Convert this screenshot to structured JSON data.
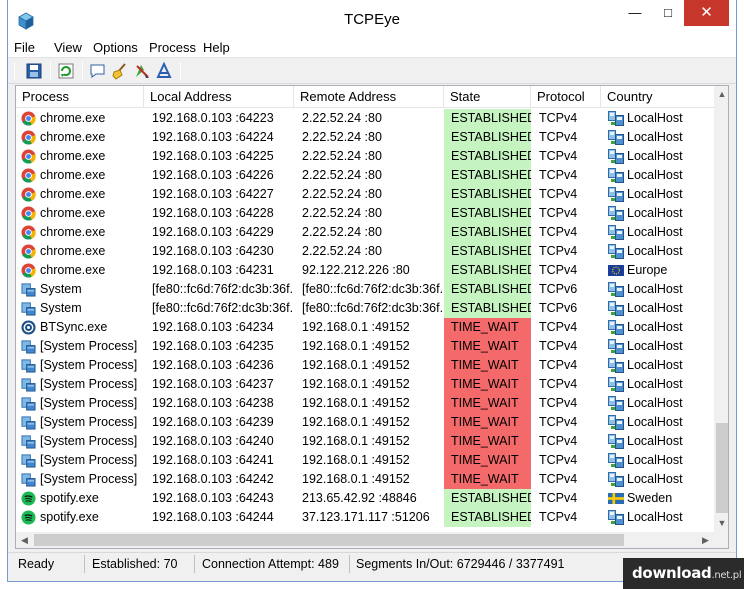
{
  "window": {
    "title": "TCPEye"
  },
  "menu": [
    "File",
    "View",
    "Options",
    "Process",
    "Help"
  ],
  "columns": [
    "Process",
    "Local Address",
    "Remote Address",
    "State",
    "Protocol",
    "Country"
  ],
  "rows": [
    {
      "icon": "chrome",
      "process": "chrome.exe",
      "local": "192.168.0.103 :64223",
      "remote": "2.22.52.24 :80",
      "state": "ESTABLISHED",
      "protocol": "TCPv4",
      "flag": "localhost",
      "country": "LocalHost"
    },
    {
      "icon": "chrome",
      "process": "chrome.exe",
      "local": "192.168.0.103 :64224",
      "remote": "2.22.52.24 :80",
      "state": "ESTABLISHED",
      "protocol": "TCPv4",
      "flag": "localhost",
      "country": "LocalHost"
    },
    {
      "icon": "chrome",
      "process": "chrome.exe",
      "local": "192.168.0.103 :64225",
      "remote": "2.22.52.24 :80",
      "state": "ESTABLISHED",
      "protocol": "TCPv4",
      "flag": "localhost",
      "country": "LocalHost"
    },
    {
      "icon": "chrome",
      "process": "chrome.exe",
      "local": "192.168.0.103 :64226",
      "remote": "2.22.52.24 :80",
      "state": "ESTABLISHED",
      "protocol": "TCPv4",
      "flag": "localhost",
      "country": "LocalHost"
    },
    {
      "icon": "chrome",
      "process": "chrome.exe",
      "local": "192.168.0.103 :64227",
      "remote": "2.22.52.24 :80",
      "state": "ESTABLISHED",
      "protocol": "TCPv4",
      "flag": "localhost",
      "country": "LocalHost"
    },
    {
      "icon": "chrome",
      "process": "chrome.exe",
      "local": "192.168.0.103 :64228",
      "remote": "2.22.52.24 :80",
      "state": "ESTABLISHED",
      "protocol": "TCPv4",
      "flag": "localhost",
      "country": "LocalHost"
    },
    {
      "icon": "chrome",
      "process": "chrome.exe",
      "local": "192.168.0.103 :64229",
      "remote": "2.22.52.24 :80",
      "state": "ESTABLISHED",
      "protocol": "TCPv4",
      "flag": "localhost",
      "country": "LocalHost"
    },
    {
      "icon": "chrome",
      "process": "chrome.exe",
      "local": "192.168.0.103 :64230",
      "remote": "2.22.52.24 :80",
      "state": "ESTABLISHED",
      "protocol": "TCPv4",
      "flag": "localhost",
      "country": "LocalHost"
    },
    {
      "icon": "chrome",
      "process": "chrome.exe",
      "local": "192.168.0.103 :64231",
      "remote": "92.122.212.226 :80",
      "state": "ESTABLISHED",
      "protocol": "TCPv4",
      "flag": "europe",
      "country": "Europe"
    },
    {
      "icon": "system",
      "process": "System",
      "local": "[fe80::fc6d:76f2:dc3b:36f...",
      "remote": "[fe80::fc6d:76f2:dc3b:36f...",
      "state": "ESTABLISHED",
      "protocol": "TCPv6",
      "flag": "localhost",
      "country": "LocalHost"
    },
    {
      "icon": "system",
      "process": "System",
      "local": "[fe80::fc6d:76f2:dc3b:36f...",
      "remote": "[fe80::fc6d:76f2:dc3b:36f...",
      "state": "ESTABLISHED",
      "protocol": "TCPv6",
      "flag": "localhost",
      "country": "LocalHost"
    },
    {
      "icon": "btsync",
      "process": "BTSync.exe",
      "local": "192.168.0.103 :64234",
      "remote": "192.168.0.1 :49152",
      "state": "TIME_WAIT",
      "protocol": "TCPv4",
      "flag": "localhost",
      "country": "LocalHost"
    },
    {
      "icon": "system",
      "process": "[System Process]",
      "local": "192.168.0.103 :64235",
      "remote": "192.168.0.1 :49152",
      "state": "TIME_WAIT",
      "protocol": "TCPv4",
      "flag": "localhost",
      "country": "LocalHost"
    },
    {
      "icon": "system",
      "process": "[System Process]",
      "local": "192.168.0.103 :64236",
      "remote": "192.168.0.1 :49152",
      "state": "TIME_WAIT",
      "protocol": "TCPv4",
      "flag": "localhost",
      "country": "LocalHost"
    },
    {
      "icon": "system",
      "process": "[System Process]",
      "local": "192.168.0.103 :64237",
      "remote": "192.168.0.1 :49152",
      "state": "TIME_WAIT",
      "protocol": "TCPv4",
      "flag": "localhost",
      "country": "LocalHost"
    },
    {
      "icon": "system",
      "process": "[System Process]",
      "local": "192.168.0.103 :64238",
      "remote": "192.168.0.1 :49152",
      "state": "TIME_WAIT",
      "protocol": "TCPv4",
      "flag": "localhost",
      "country": "LocalHost"
    },
    {
      "icon": "system",
      "process": "[System Process]",
      "local": "192.168.0.103 :64239",
      "remote": "192.168.0.1 :49152",
      "state": "TIME_WAIT",
      "protocol": "TCPv4",
      "flag": "localhost",
      "country": "LocalHost"
    },
    {
      "icon": "system",
      "process": "[System Process]",
      "local": "192.168.0.103 :64240",
      "remote": "192.168.0.1 :49152",
      "state": "TIME_WAIT",
      "protocol": "TCPv4",
      "flag": "localhost",
      "country": "LocalHost"
    },
    {
      "icon": "system",
      "process": "[System Process]",
      "local": "192.168.0.103 :64241",
      "remote": "192.168.0.1 :49152",
      "state": "TIME_WAIT",
      "protocol": "TCPv4",
      "flag": "localhost",
      "country": "LocalHost"
    },
    {
      "icon": "system",
      "process": "[System Process]",
      "local": "192.168.0.103 :64242",
      "remote": "192.168.0.1 :49152",
      "state": "TIME_WAIT",
      "protocol": "TCPv4",
      "flag": "localhost",
      "country": "LocalHost"
    },
    {
      "icon": "spotify",
      "process": "spotify.exe",
      "local": "192.168.0.103 :64243",
      "remote": "213.65.42.92 :48846",
      "state": "ESTABLISHED",
      "protocol": "TCPv4",
      "flag": "sweden",
      "country": "Sweden"
    },
    {
      "icon": "spotify",
      "process": "spotify.exe",
      "local": "192.168.0.103 :64244",
      "remote": "37.123.171.117 :51206",
      "state": "ESTABLISHED",
      "protocol": "TCPv4",
      "flag": "localhost",
      "country": "LocalHost"
    }
  ],
  "status": {
    "ready": "Ready",
    "established": "Established: 70",
    "attempt": "Connection Attempt: 489",
    "segments": "Segments In/Out: 6729446 / 3377491"
  },
  "watermark": {
    "main": "download",
    "suffix": ".net.pl"
  },
  "colors": {
    "established": "#c5f4c0",
    "time_wait": "#f46a6a",
    "close_button": "#c7362b"
  }
}
